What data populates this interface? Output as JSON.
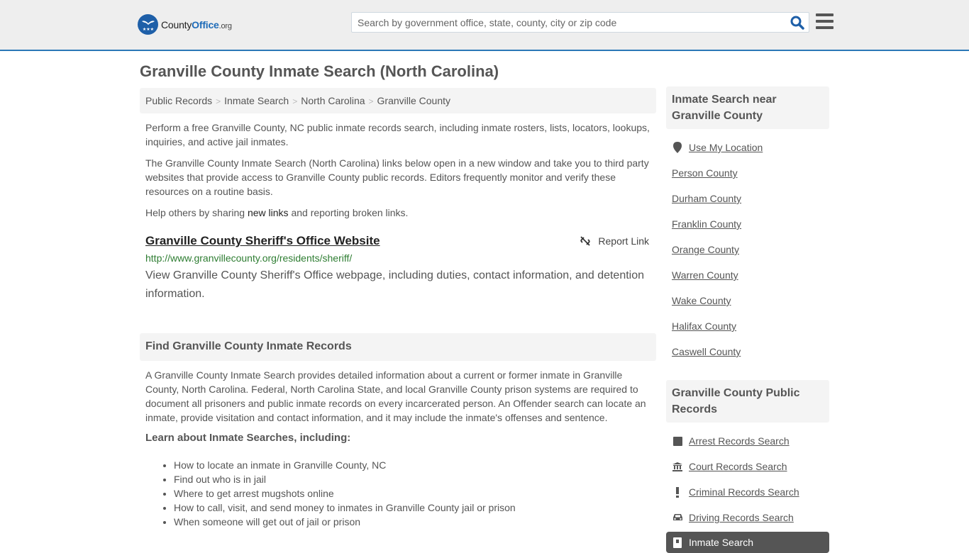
{
  "header": {
    "logo": {
      "name_part1": "County",
      "name_part2": "Office",
      "name_part3": ".org"
    },
    "search": {
      "placeholder": "Search by government office, state, county, city or zip code",
      "value": ""
    },
    "brand_color": "#1e5fa8",
    "accent_border": "#2b78b7"
  },
  "page": {
    "title": "Granville County Inmate Search (North Carolina)"
  },
  "breadcrumb": [
    {
      "label": "Public Records"
    },
    {
      "label": "Inmate Search"
    },
    {
      "label": "North Carolina"
    },
    {
      "label": "Granville County"
    }
  ],
  "intro": {
    "p1": "Perform a free Granville County, NC public inmate records search, including inmate rosters, lists, locators, lookups, inquiries, and active jail inmates.",
    "p2": "The Granville County Inmate Search (North Carolina) links below open in a new window and take you to third party websites that provide access to Granville County public records. Editors frequently monitor and verify these resources on a routine basis.",
    "p3_before": "Help others by sharing ",
    "p3_link": "new links",
    "p3_after": " and reporting broken links."
  },
  "results": [
    {
      "title": "Granville County Sheriff's Office Website",
      "url": "http://www.granvillecounty.org/residents/sheriff/",
      "description": "View Granville County Sheriff's Office webpage, including duties, contact information, and detention information.",
      "report_label": "Report Link"
    }
  ],
  "find_section": {
    "heading": "Find Granville County Inmate Records",
    "body": "A Granville County Inmate Search provides detailed information about a current or former inmate in Granville County, North Carolina. Federal, North Carolina State, and local Granville County prison systems are required to document all prisoners and public inmate records on every incarcerated person. An Offender search can locate an inmate, provide visitation and contact information, and it may include the inmate's offenses and sentence.",
    "learn_heading": "Learn about Inmate Searches, including:",
    "topics": [
      "How to locate an inmate in Granville County, NC",
      "Find out who is in jail",
      "Where to get arrest mugshots online",
      "How to call, visit, and send money to inmates in Granville County jail or prison",
      "When someone will get out of jail or prison"
    ]
  },
  "sidebar": {
    "nearby": {
      "heading": "Inmate Search near Granville County",
      "use_location": "Use My Location",
      "counties": [
        "Person County",
        "Durham County",
        "Franklin County",
        "Orange County",
        "Warren County",
        "Wake County",
        "Halifax County",
        "Caswell County"
      ]
    },
    "public_records": {
      "heading": "Granville County Public Records",
      "items": [
        {
          "label": "Arrest Records Search",
          "icon": "square-icon"
        },
        {
          "label": "Court Records Search",
          "icon": "courthouse-icon"
        },
        {
          "label": "Criminal Records Search",
          "icon": "exclamation-icon"
        },
        {
          "label": "Driving Records Search",
          "icon": "car-icon"
        }
      ],
      "active_item": {
        "label": "Inmate Search",
        "icon": "inmate-icon"
      }
    }
  }
}
